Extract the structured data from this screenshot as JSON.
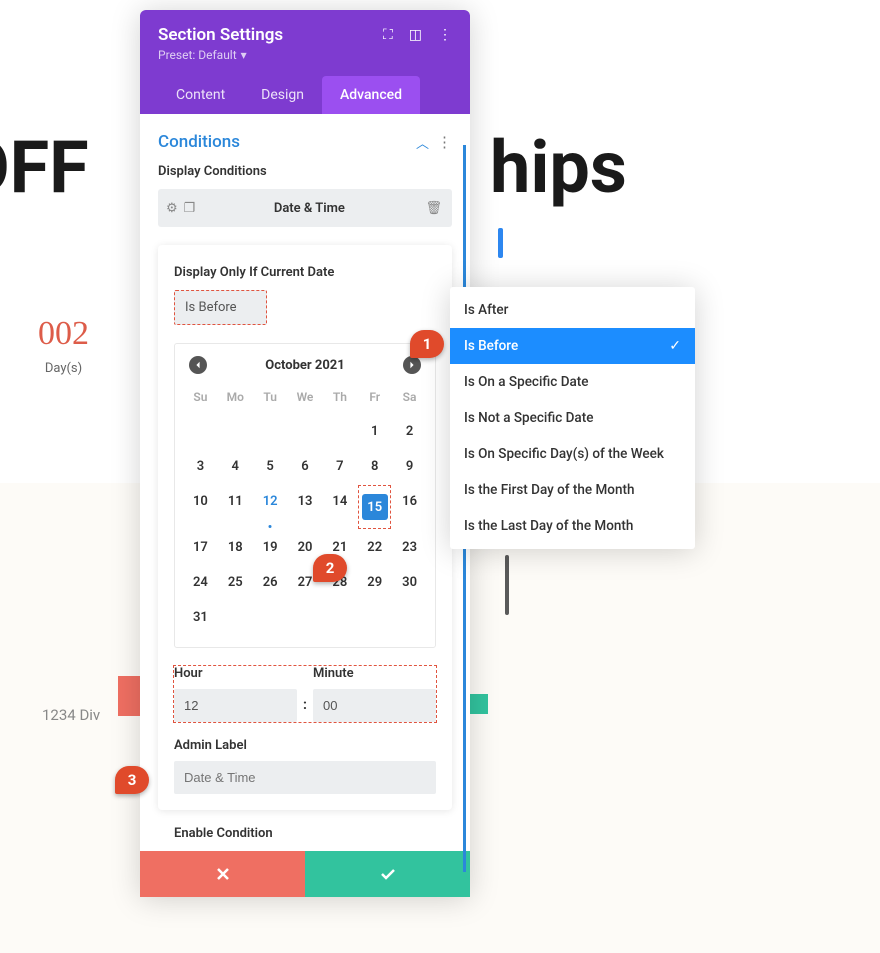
{
  "bg": {
    "text_left": "OFF",
    "text_right": "hips",
    "counter_num": "002",
    "counter_label": "Day(s)",
    "address": "1234 Div"
  },
  "panel": {
    "title": "Section Settings",
    "preset": "Preset: Default",
    "tabs": {
      "content": "Content",
      "design": "Design",
      "advanced": "Advanced"
    },
    "active_tab": "Advanced",
    "section_title": "Conditions",
    "display_conditions": "Display Conditions",
    "condition_name": "Date & Time",
    "display_only_if": "Display Only If Current Date",
    "operator_selected": "Is Before",
    "calendar": {
      "month": "October 2021",
      "dow": [
        "Su",
        "Mo",
        "Tu",
        "We",
        "Th",
        "Fr",
        "Sa"
      ],
      "leading_blanks": 5,
      "days": 31,
      "today": 12,
      "selected": 15
    },
    "hour_label": "Hour",
    "minute_label": "Minute",
    "hour": "12",
    "minute": "00",
    "admin_label_title": "Admin Label",
    "admin_label_placeholder": "Date & Time",
    "enable_condition": "Enable Condition"
  },
  "dropdown": {
    "options": [
      "Is After",
      "Is Before",
      "Is On a Specific Date",
      "Is Not a Specific Date",
      "Is On Specific Day(s) of the Week",
      "Is the First Day of the Month",
      "Is the Last Day of the Month"
    ],
    "selected_index": 1
  },
  "markers": {
    "m1": "1",
    "m2": "2",
    "m3": "3"
  }
}
